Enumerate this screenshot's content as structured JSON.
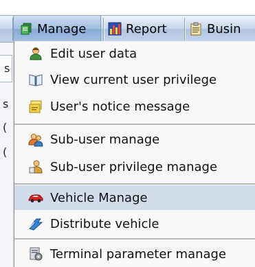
{
  "menubar": {
    "items": [
      {
        "label": "Manage",
        "icon": "manage-icon"
      },
      {
        "label": "Report",
        "icon": "report-chart-icon"
      },
      {
        "label": "Busin",
        "icon": "clipboard-icon"
      }
    ]
  },
  "background": {
    "tab_letter": "s",
    "side_letters": [
      "s",
      "(",
      "("
    ]
  },
  "dropdown": {
    "items": [
      {
        "label": "Edit user data",
        "icon": "user-edit-icon"
      },
      {
        "label": "View current user privilege",
        "icon": "book-icon"
      },
      {
        "label": "User's notice message",
        "icon": "notice-note-icon"
      },
      {
        "label": "Sub-user manage",
        "icon": "users-group-icon"
      },
      {
        "label": "Sub-user privilege manage",
        "icon": "user-privilege-icon"
      },
      {
        "label": "Vehicle Manage",
        "icon": "car-icon"
      },
      {
        "label": "Distribute vehicle",
        "icon": "distribute-arrows-icon"
      },
      {
        "label": "Terminal parameter manage",
        "icon": "terminal-settings-icon"
      }
    ]
  },
  "colors": {
    "highlight": "#d2dcea",
    "menubar": "#c6d6ea"
  }
}
